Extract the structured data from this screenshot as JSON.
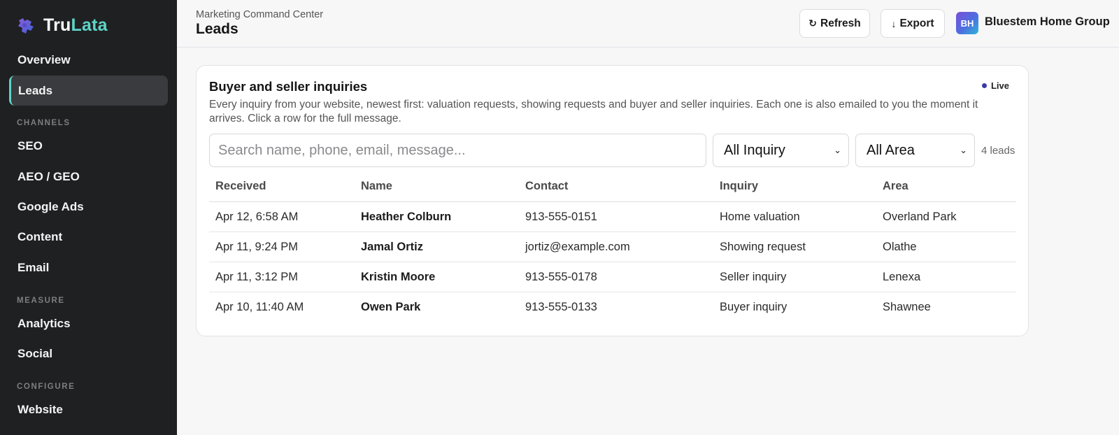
{
  "brand": {
    "name_part1": "Tru",
    "name_part2": "Lata",
    "accent": "#5fd3c8"
  },
  "sidebar": {
    "items": [
      {
        "label": "Overview"
      },
      {
        "label": "Leads",
        "active": true
      },
      {
        "label": "SEO"
      },
      {
        "label": "AEO / GEO"
      },
      {
        "label": "Google Ads"
      },
      {
        "label": "Content"
      },
      {
        "label": "Email"
      },
      {
        "label": "Analytics"
      },
      {
        "label": "Social"
      },
      {
        "label": "Website"
      }
    ],
    "sections": [
      "CHANNELS",
      "MEASURE",
      "CONFIGURE"
    ]
  },
  "header": {
    "eyebrow": "Marketing Command Center",
    "title": "Leads",
    "refresh_label": "Refresh",
    "export_label": "Export",
    "avatar_initials": "BH",
    "org_name": "Bluestem Home Group"
  },
  "card": {
    "title": "Buyer and seller inquiries",
    "live_label": "Live",
    "description": "Every inquiry from your website, newest first: valuation requests, showing requests and buyer and seller inquiries. Each one is also emailed to you the moment it arrives. Click a row for the full message.",
    "search_placeholder": "Search name, phone, email, message...",
    "inquiry_filter": "All Inquiry",
    "area_filter": "All Area",
    "lead_count": "4 leads"
  },
  "table": {
    "columns": [
      "Received",
      "Name",
      "Contact",
      "Inquiry",
      "Area"
    ],
    "rows": [
      {
        "received": "Apr 12, 6:58 AM",
        "name": "Heather Colburn",
        "contact": "913-555-0151",
        "inquiry": "Home valuation",
        "area": "Overland Park"
      },
      {
        "received": "Apr 11, 9:24 PM",
        "name": "Jamal Ortiz",
        "contact": "jortiz@example.com",
        "inquiry": "Showing request",
        "area": "Olathe"
      },
      {
        "received": "Apr 11, 3:12 PM",
        "name": "Kristin Moore",
        "contact": "913-555-0178",
        "inquiry": "Seller inquiry",
        "area": "Lenexa"
      },
      {
        "received": "Apr 10, 11:40 AM",
        "name": "Owen Park",
        "contact": "913-555-0133",
        "inquiry": "Buyer inquiry",
        "area": "Shawnee"
      }
    ]
  },
  "icons": {
    "logo": "puzzle-logo-icon",
    "refresh": "refresh-icon",
    "export": "arrow-down-icon",
    "live": "live-dot-icon",
    "select": "chevron-down-icon"
  }
}
